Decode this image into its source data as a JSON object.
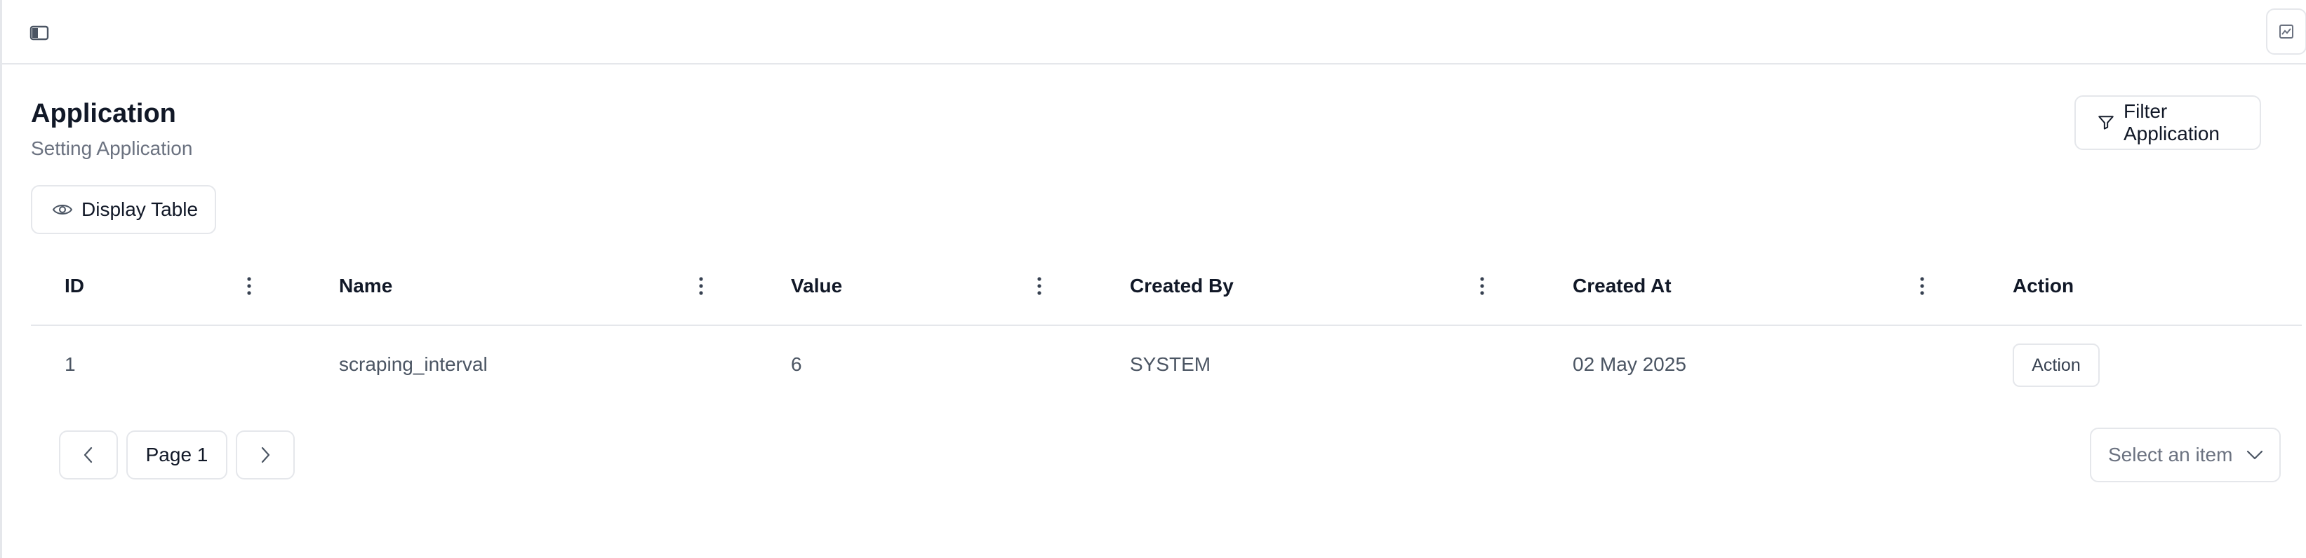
{
  "header": {
    "sidebar_toggle_icon": "sidebar-panel-icon",
    "chart_icon": "line-chart-icon"
  },
  "page": {
    "title": "Application",
    "subtitle": "Setting Application"
  },
  "toolbar": {
    "filter_label": "Filter Application",
    "filter_icon": "funnel-icon",
    "display_label": "Display Table",
    "display_icon": "eye-icon"
  },
  "table": {
    "columns": [
      "ID",
      "Name",
      "Value",
      "Created By",
      "Created At",
      "Action"
    ],
    "rows": [
      {
        "id": "1",
        "name": "scraping_interval",
        "value": "6",
        "created_by": "SYSTEM",
        "created_at": "02 May 2025",
        "action": "Action"
      }
    ]
  },
  "pagination": {
    "page_label": "Page 1",
    "page_size_placeholder": "Select an item"
  }
}
